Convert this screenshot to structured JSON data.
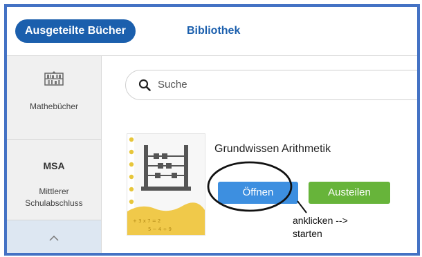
{
  "header": {
    "active_tab_label": "Ausgeteilte Bücher",
    "tab_library_label": "Bibliothek"
  },
  "sidebar": {
    "items": [
      {
        "icon": "bookshelf-icon",
        "label": "Mathebücher"
      },
      {
        "abbr": "MSA",
        "label_line1": "Mittlerer",
        "label_line2": "Schulabschluss"
      },
      {
        "icon": "chevron-up-icon"
      }
    ]
  },
  "search": {
    "placeholder": "Suche",
    "icon": "search-icon"
  },
  "book": {
    "title": "Grundwissen Arithmetik",
    "cover_icon": "abacus-icon",
    "open_label": "Öffnen",
    "lend_label": "Austeilen"
  },
  "annotation": {
    "note_line1": "anklicken -->",
    "note_line2": "starten"
  },
  "colors": {
    "frame": "#4472c4",
    "brand_blue": "#1b5fad",
    "open_button": "#3d8fe0",
    "lend_button": "#67b43a"
  }
}
